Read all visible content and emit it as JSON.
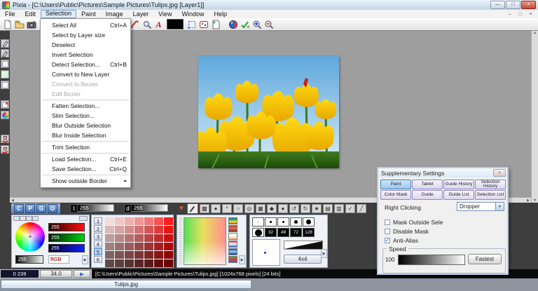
{
  "window": {
    "title": "Pixia - [C:\\Users\\Public\\Pictures\\Sample Pictures\\Tulips.jpg [Layer1]]"
  },
  "menubar": {
    "items": [
      "File",
      "Edit",
      "Selection",
      "Paint",
      "Image",
      "Layer",
      "View",
      "Window",
      "Help"
    ],
    "active": "Selection"
  },
  "selection_menu": {
    "items": [
      {
        "label": "Select All",
        "shortcut": "Ctrl+A"
      },
      {
        "label": "Select by Layer size"
      },
      {
        "label": "Deselect"
      },
      {
        "label": "Invert Selection"
      },
      {
        "label": "Detect Selection...",
        "shortcut": "Ctrl+B"
      },
      {
        "label": "Convert to New Layer"
      },
      {
        "label": "Convert to Bezier",
        "disabled": true
      },
      {
        "label": "Edit Bezier",
        "disabled": true,
        "sep_after": true
      },
      {
        "label": "Fatten Selection..."
      },
      {
        "label": "Slim Selection..."
      },
      {
        "label": "Blur Outside Selection"
      },
      {
        "label": "Blur Inside Selection",
        "sep_after": true
      },
      {
        "label": "Trim Selection",
        "sep_after": true
      },
      {
        "label": "Load Selection...",
        "shortcut": "Ctrl+E"
      },
      {
        "label": "Save Selection...",
        "shortcut": "Ctrl+Q",
        "sep_after": true
      },
      {
        "label": "Show outside Border",
        "submenu": true
      }
    ]
  },
  "toolbar": {
    "icons": [
      "new-file",
      "open-folder",
      "save-camera",
      "eraser",
      "magnifier",
      "text-tool",
      "color-swatch",
      "select-move",
      "dice",
      "page-options",
      "sphere",
      "edit-check",
      "zoom-in",
      "zoom-out"
    ]
  },
  "tool_column": {
    "icons": [
      "pen",
      "pen-alt",
      "rect-select",
      "gradient-fill",
      "rect-frame",
      "clear-selection",
      "color-ball",
      "fill-bucket",
      "pour-bucket"
    ]
  },
  "color_toolbar": {
    "buttons": [
      "C",
      "P",
      "G",
      "O"
    ],
    "t_label": "t",
    "t_value": "255",
    "d_label": "d",
    "d_value": "255",
    "icons": [
      "half-tone",
      "dot",
      "comma",
      "circle",
      "ring",
      "pattern",
      "diamond",
      "filled-circle",
      "undo-arrow",
      "redo-arrow",
      "star",
      "copy",
      "clipboard",
      "check",
      "pen-edit"
    ]
  },
  "panel_wheel": {
    "r": "255",
    "g": "255",
    "b": "255",
    "gray": "255",
    "mode_label": "RGB"
  },
  "panel_swatches": {
    "row_buttons": [
      "1",
      "2",
      "3",
      "4",
      "5",
      "6"
    ],
    "selected": "5",
    "palette": [
      [
        "#f2dcdc",
        "#f0c6c6",
        "#eeafaf",
        "#ee9595",
        "#f07878",
        "#f55252",
        "#fa1e1e"
      ],
      [
        "#d8baba",
        "#d4a3a3",
        "#d18c8c",
        "#d07272",
        "#d35656",
        "#dc3a3a",
        "#e61616"
      ],
      [
        "#bb9c9c",
        "#b88888",
        "#b57272",
        "#b55c5c",
        "#b84444",
        "#c02c2c",
        "#cc1010"
      ],
      [
        "#9e8080",
        "#9c6e6e",
        "#995c5c",
        "#994848",
        "#9c3434",
        "#a42020",
        "#b00808"
      ],
      [
        "#7f6464",
        "#7d5555",
        "#7a4646",
        "#7a3636",
        "#7d2626",
        "#851414",
        "#8f0404"
      ],
      [
        "#5e4a4a",
        "#5c3e3e",
        "#593232",
        "#592626",
        "#5c1a1a",
        "#630c0c",
        "#6b0202"
      ]
    ]
  },
  "panel_gradient": {
    "presets": [
      "rainbow",
      "copper",
      "pastel",
      "tricolor",
      "blue",
      "green-red"
    ]
  },
  "panel_brush": {
    "size_labels": [
      "32",
      "48",
      "72",
      "128"
    ],
    "grid_label": "4x4"
  },
  "supplementary": {
    "title": "Supplementary Settings",
    "tabs": [
      {
        "label": "Paint",
        "active": true
      },
      {
        "label": "Tablet"
      },
      {
        "label": "Guide History"
      },
      {
        "label": "Selection History"
      },
      {
        "label": "Color Mask"
      },
      {
        "label": "Guide"
      },
      {
        "label": "Guide List"
      },
      {
        "label": "Selection List"
      }
    ],
    "right_clicking_label": "Right Clicking",
    "right_clicking_value": "Dropper",
    "checkboxes": [
      {
        "label": "Mask Outside Sele",
        "checked": false
      },
      {
        "label": "Disable Mask",
        "checked": false
      },
      {
        "label": "Anti-Alias",
        "checked": true
      }
    ],
    "speed_label": "Speed",
    "speed_value": "100",
    "speed_button": "Fastest"
  },
  "statusbar": {
    "coords": "0 239",
    "zoom": "34.0",
    "path": "[C:\\Users\\Public\\Pictures\\Sample Pictures\\Tulips.jpg] [1024x768 pixels] [24 bits]"
  },
  "taskbar": {
    "item": "Tulips.jpg"
  },
  "colors": {
    "titlebar": "#c2d6e8",
    "close_button": "#c04a32",
    "canvas_gray": "#9e9e9e",
    "panel_border": "#9fb2cc",
    "active_tab_blue": "#9cc8ee"
  }
}
